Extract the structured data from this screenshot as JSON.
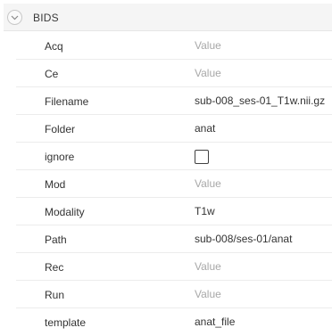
{
  "section": {
    "title": "BIDS",
    "toggle_icon": "chevron-down-icon"
  },
  "rows": [
    {
      "label": "Acq",
      "value": "",
      "placeholder": "Value"
    },
    {
      "label": "Ce",
      "value": "",
      "placeholder": "Value"
    },
    {
      "label": "Filename",
      "value": "sub-008_ses-01_T1w.nii.gz",
      "placeholder": "Value"
    },
    {
      "label": "Folder",
      "value": "anat",
      "placeholder": "Value"
    },
    {
      "label": "ignore",
      "checked": false
    },
    {
      "label": "Mod",
      "value": "",
      "placeholder": "Value"
    },
    {
      "label": "Modality",
      "value": "T1w",
      "placeholder": "Value"
    },
    {
      "label": "Path",
      "value": "sub-008/ses-01/anat",
      "placeholder": "Value"
    },
    {
      "label": "Rec",
      "value": "",
      "placeholder": "Value"
    },
    {
      "label": "Run",
      "value": "",
      "placeholder": "Value"
    },
    {
      "label": "template",
      "value": "anat_file",
      "placeholder": "Value"
    }
  ]
}
